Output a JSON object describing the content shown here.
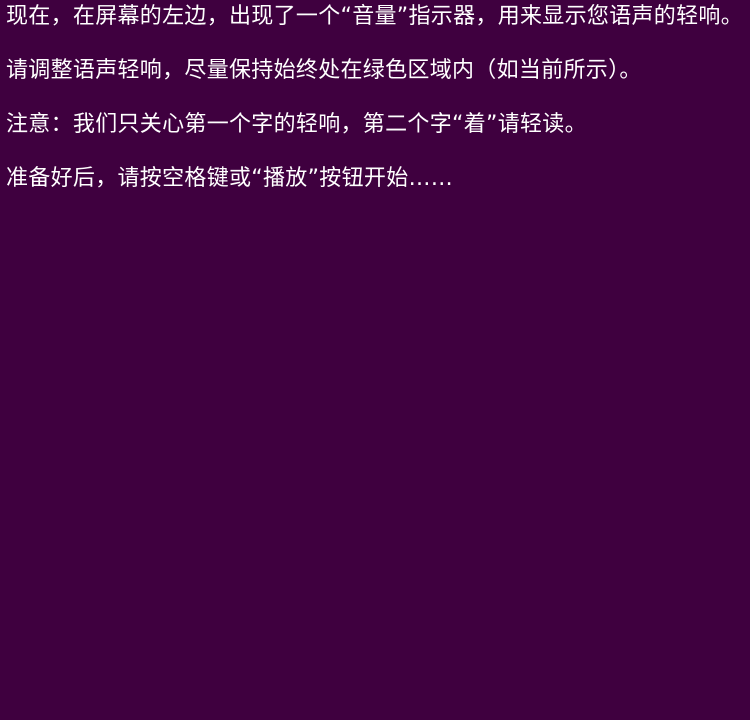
{
  "instructions": {
    "paragraph_1": "现在，在屏幕的左边，出现了一个“音量”指示器，用来显示您语声的轻响。",
    "paragraph_2": "请调整语声轻响，尽量保持始终处在绿色区域内（如当前所示）。",
    "paragraph_3": "注意：我们只关心第一个字的轻响，第二个字“着”请轻读。",
    "paragraph_4": "准备好后，请按空格键或“播放”按钮开始……"
  },
  "colors": {
    "background": "#3f003f",
    "text": "#ffffff"
  }
}
